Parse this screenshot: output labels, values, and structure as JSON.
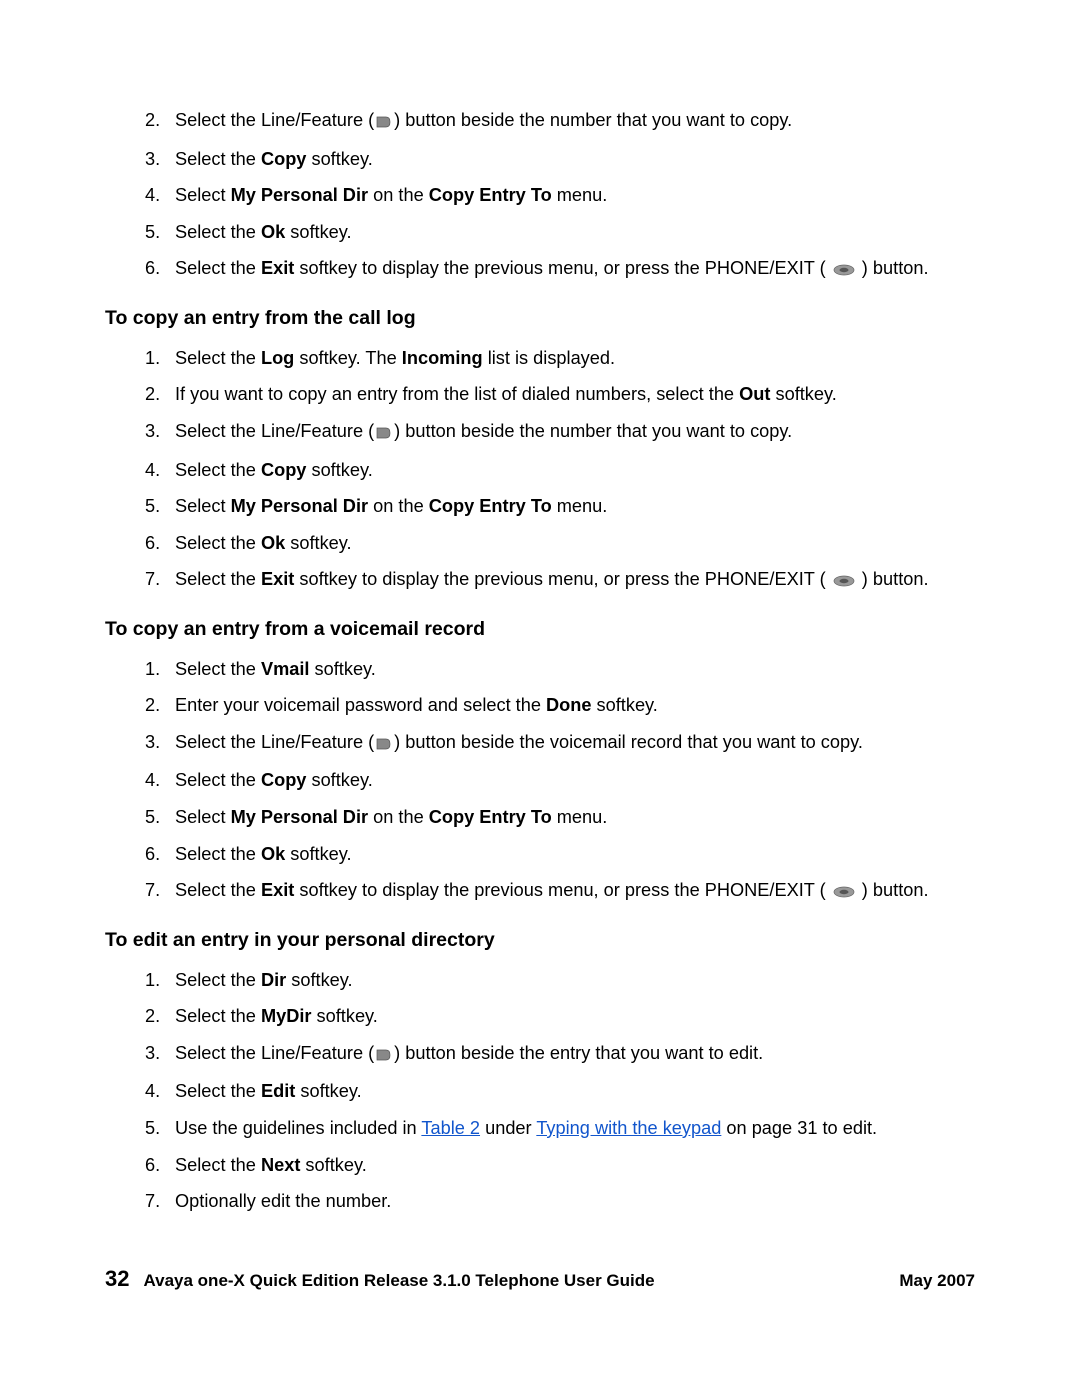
{
  "section1": {
    "start": 2,
    "items": [
      {
        "pre": "Select the Line/Feature (",
        "icon": "line-feature",
        "post": ") button beside the number that you want to copy."
      },
      {
        "segments": [
          {
            "t": "Select the "
          },
          {
            "t": "Copy",
            "b": true
          },
          {
            "t": " softkey."
          }
        ]
      },
      {
        "segments": [
          {
            "t": "Select "
          },
          {
            "t": "My Personal Dir",
            "b": true
          },
          {
            "t": " on the "
          },
          {
            "t": "Copy Entry To",
            "b": true
          },
          {
            "t": " menu."
          }
        ]
      },
      {
        "segments": [
          {
            "t": "Select the "
          },
          {
            "t": "Ok",
            "b": true
          },
          {
            "t": " softkey."
          }
        ]
      },
      {
        "segments": [
          {
            "t": "Select the "
          },
          {
            "t": "Exit",
            "b": true
          },
          {
            "t": " softkey to display the previous menu, or press the PHONE/EXIT ( "
          }
        ],
        "icon_after": "phone-exit",
        "tail": " ) button."
      }
    ]
  },
  "section2": {
    "heading": "To copy an entry from the call log",
    "start": 1,
    "items": [
      {
        "segments": [
          {
            "t": "Select the "
          },
          {
            "t": "Log",
            "b": true
          },
          {
            "t": " softkey. The "
          },
          {
            "t": "Incoming",
            "b": true
          },
          {
            "t": " list is displayed."
          }
        ]
      },
      {
        "segments": [
          {
            "t": "If you want to copy an entry from the list of dialed numbers, select the "
          },
          {
            "t": "Out",
            "b": true
          },
          {
            "t": " softkey."
          }
        ]
      },
      {
        "pre": "Select the Line/Feature (",
        "icon": "line-feature",
        "post": ") button beside the number that you want to copy."
      },
      {
        "segments": [
          {
            "t": "Select the "
          },
          {
            "t": "Copy",
            "b": true
          },
          {
            "t": " softkey."
          }
        ]
      },
      {
        "segments": [
          {
            "t": "Select "
          },
          {
            "t": "My Personal Dir",
            "b": true
          },
          {
            "t": " on the "
          },
          {
            "t": "Copy Entry To",
            "b": true
          },
          {
            "t": " menu."
          }
        ]
      },
      {
        "segments": [
          {
            "t": "Select the "
          },
          {
            "t": "Ok",
            "b": true
          },
          {
            "t": " softkey."
          }
        ]
      },
      {
        "segments": [
          {
            "t": "Select the "
          },
          {
            "t": "Exit",
            "b": true
          },
          {
            "t": " softkey to display the previous menu, or press the PHONE/EXIT ( "
          }
        ],
        "icon_after": "phone-exit",
        "tail": " ) button."
      }
    ]
  },
  "section3": {
    "heading": "To copy an entry from a voicemail record",
    "start": 1,
    "items": [
      {
        "segments": [
          {
            "t": "Select the "
          },
          {
            "t": "Vmail",
            "b": true
          },
          {
            "t": " softkey."
          }
        ]
      },
      {
        "segments": [
          {
            "t": "Enter your voicemail password and select the "
          },
          {
            "t": "Done",
            "b": true
          },
          {
            "t": " softkey."
          }
        ]
      },
      {
        "pre": "Select the Line/Feature (",
        "icon": "line-feature",
        "post": ") button beside the voicemail record that you want to copy."
      },
      {
        "segments": [
          {
            "t": "Select the "
          },
          {
            "t": "Copy",
            "b": true
          },
          {
            "t": " softkey."
          }
        ]
      },
      {
        "segments": [
          {
            "t": "Select "
          },
          {
            "t": "My Personal Dir",
            "b": true
          },
          {
            "t": " on the "
          },
          {
            "t": "Copy Entry To",
            "b": true
          },
          {
            "t": " menu."
          }
        ]
      },
      {
        "segments": [
          {
            "t": "Select the "
          },
          {
            "t": "Ok",
            "b": true
          },
          {
            "t": " softkey."
          }
        ]
      },
      {
        "segments": [
          {
            "t": "Select the "
          },
          {
            "t": "Exit",
            "b": true
          },
          {
            "t": " softkey to display the previous menu, or press the PHONE/EXIT ( "
          }
        ],
        "icon_after": "phone-exit",
        "tail": " ) button."
      }
    ]
  },
  "section4": {
    "heading": "To edit an entry in your personal directory",
    "start": 1,
    "items": [
      {
        "segments": [
          {
            "t": "Select the "
          },
          {
            "t": "Dir",
            "b": true
          },
          {
            "t": " softkey."
          }
        ]
      },
      {
        "segments": [
          {
            "t": "Select the "
          },
          {
            "t": "MyDir",
            "b": true
          },
          {
            "t": " softkey."
          }
        ]
      },
      {
        "pre": "Select the Line/Feature (",
        "icon": "line-feature",
        "post": ") button beside the entry that you want to edit."
      },
      {
        "segments": [
          {
            "t": "Select the "
          },
          {
            "t": "Edit",
            "b": true
          },
          {
            "t": " softkey."
          }
        ]
      },
      {
        "segments": [
          {
            "t": "Use the guidelines included in "
          },
          {
            "t": "Table 2",
            "link": true
          },
          {
            "t": " under "
          },
          {
            "t": "Typing with the keypad",
            "link": true
          },
          {
            "t": " on page 31 to edit."
          }
        ]
      },
      {
        "segments": [
          {
            "t": "Select the "
          },
          {
            "t": "Next",
            "b": true
          },
          {
            "t": " softkey."
          }
        ]
      },
      {
        "segments": [
          {
            "t": "Optionally edit the number."
          }
        ]
      }
    ]
  },
  "footer": {
    "page": "32",
    "title": "Avaya one-X Quick Edition Release 3.1.0 Telephone User Guide",
    "date": "May 2007"
  }
}
